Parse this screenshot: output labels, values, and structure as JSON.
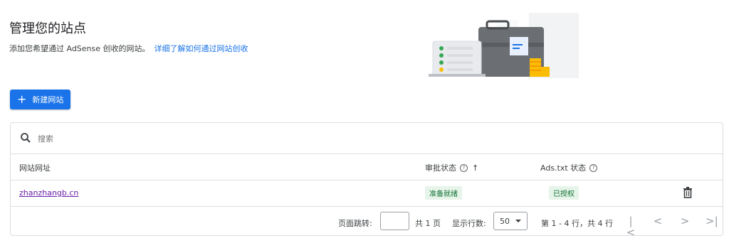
{
  "page": {
    "title": "管理您的站点",
    "subtitle": "添加您希望通过 AdSense 创收的网站。",
    "learn_more": "详细了解如何通过网站创收"
  },
  "new_site_button": {
    "icon": "plus-icon",
    "label": "新建网站"
  },
  "search": {
    "icon": "search-icon",
    "placeholder": "搜索"
  },
  "table": {
    "columns": [
      {
        "label": "网站网址"
      },
      {
        "label": "审批状态",
        "help_icon": "help-icon",
        "sort_icon": "arrow-up-icon"
      },
      {
        "label": "Ads.txt 状态",
        "help_icon": "help-icon"
      }
    ],
    "rows": [
      {
        "site": "zhanzhangb.cn",
        "approval": "准备就绪",
        "ads_txt": "已授权",
        "action_icon": "trash-icon"
      }
    ]
  },
  "pagination": {
    "jump_label": "页面跳转:",
    "jump_value": "",
    "total_pages": "共 1 页",
    "rows_label": "显示行数:",
    "rows_value": "50",
    "range": "第 1 - 4 行，共 4 行"
  },
  "colors": {
    "primary": "#1a73e8",
    "badge_bg": "#e6f4ea",
    "badge_text": "#137333",
    "link_visited": "#681da8"
  }
}
